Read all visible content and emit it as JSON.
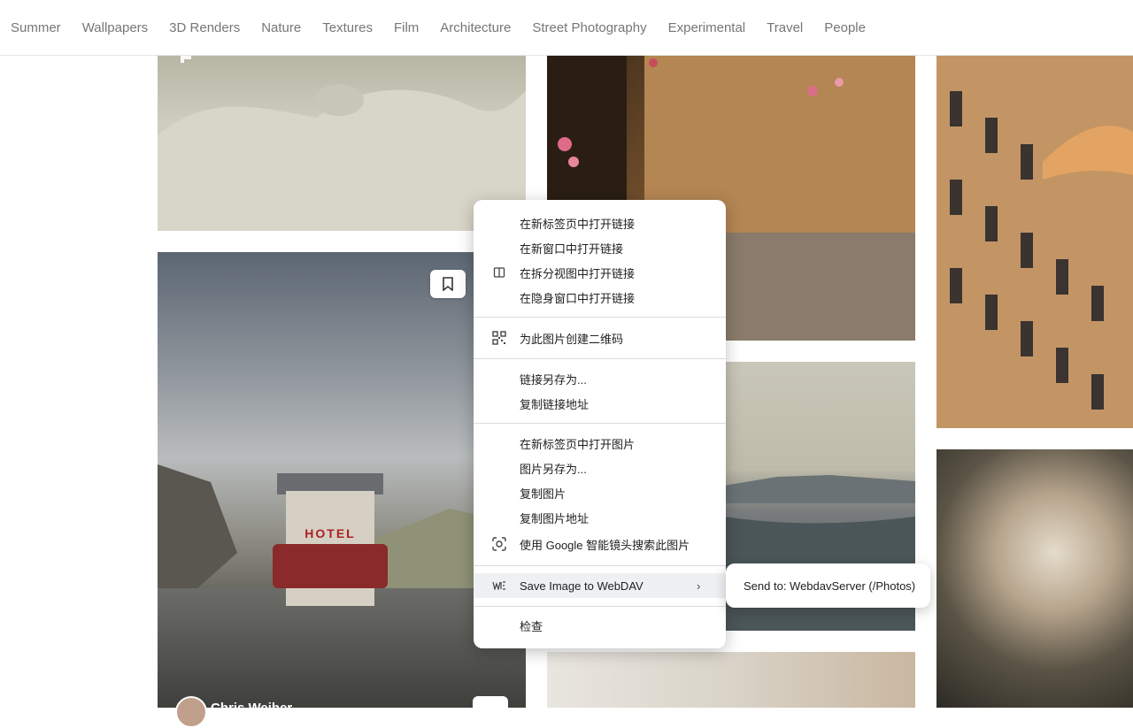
{
  "nav": {
    "tabs": [
      "Summer",
      "Wallpapers",
      "3D Renders",
      "Nature",
      "Textures",
      "Film",
      "Architecture",
      "Street Photography",
      "Experimental",
      "Travel",
      "People"
    ]
  },
  "photos": {
    "hotel_sign": "HOTEL",
    "author_name": "Chris Weiher"
  },
  "context_menu": {
    "items": [
      {
        "label": "在新标签页中打开链接",
        "icon": ""
      },
      {
        "label": "在新窗口中打开链接",
        "icon": ""
      },
      {
        "label": "在拆分视图中打开链接",
        "icon": "split-view-icon"
      },
      {
        "label": "在隐身窗口中打开链接",
        "icon": ""
      },
      {
        "label": "为此图片创建二维码",
        "icon": "qr-code-icon"
      },
      {
        "label": "链接另存为...",
        "icon": ""
      },
      {
        "label": "复制链接地址",
        "icon": ""
      },
      {
        "label": "在新标签页中打开图片",
        "icon": ""
      },
      {
        "label": "图片另存为...",
        "icon": ""
      },
      {
        "label": "复制图片",
        "icon": ""
      },
      {
        "label": "复制图片地址",
        "icon": ""
      },
      {
        "label": "使用 Google 智能镜头搜索此图片",
        "icon": "google-lens-icon"
      },
      {
        "label": "Save Image to WebDAV",
        "icon": "webdav-icon"
      },
      {
        "label": "检查",
        "icon": ""
      }
    ],
    "submenu_chevron": "›"
  },
  "submenu": {
    "item": "Send to: WebdavServer (/Photos)"
  }
}
